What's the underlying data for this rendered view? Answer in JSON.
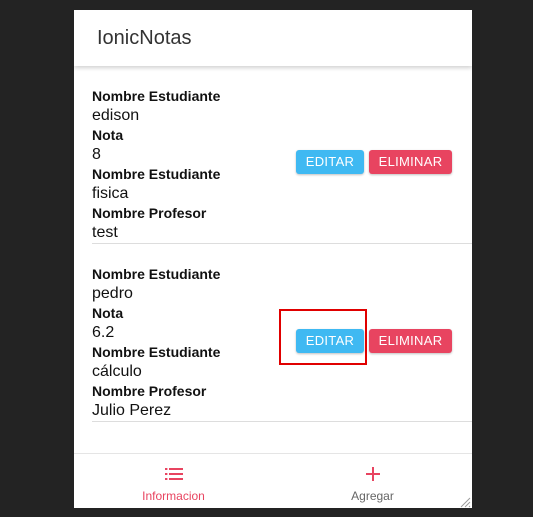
{
  "app": {
    "title": "IonicNotas"
  },
  "colors": {
    "primary": "#3fb9f2",
    "danger": "#e84460",
    "highlight": "#e00000",
    "background": "#232323"
  },
  "notes": [
    {
      "fields": [
        {
          "label": "Nombre Estudiante",
          "value": "edison"
        },
        {
          "label": "Nota",
          "value": "8"
        },
        {
          "label": "Nombre Estudiante",
          "value": "fisica"
        },
        {
          "label": "Nombre Profesor",
          "value": "test"
        }
      ],
      "edit_label": "EDITAR",
      "delete_label": "ELIMINAR"
    },
    {
      "fields": [
        {
          "label": "Nombre Estudiante",
          "value": "pedro"
        },
        {
          "label": "Nota",
          "value": "6.2"
        },
        {
          "label": "Nombre Estudiante",
          "value": "cálculo"
        },
        {
          "label": "Nombre Profesor",
          "value": "Julio Perez"
        }
      ],
      "edit_label": "EDITAR",
      "delete_label": "ELIMINAR"
    }
  ],
  "tabs": [
    {
      "label": "Informacion",
      "icon": "list-icon",
      "active": true
    },
    {
      "label": "Agregar",
      "icon": "plus-icon",
      "active": false
    }
  ]
}
